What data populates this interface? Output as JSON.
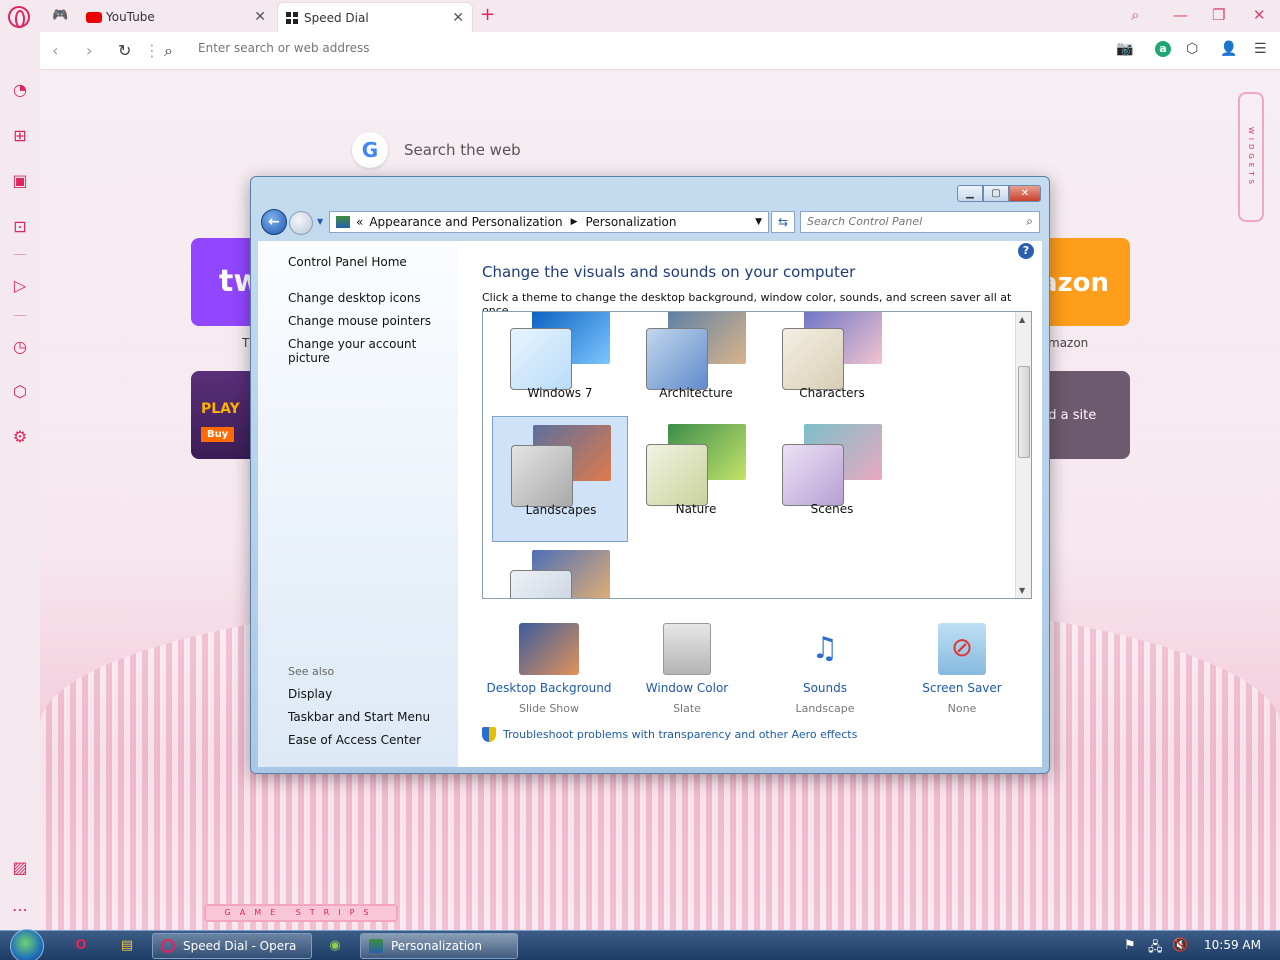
{
  "browser": {
    "tabs": [
      {
        "label": "YouTube",
        "active": false
      },
      {
        "label": "Speed Dial",
        "active": true
      }
    ],
    "address_placeholder": "Enter search or web address",
    "accent_color": "#e0245e"
  },
  "speed_dial": {
    "search_text": "Search the web",
    "tiles": [
      {
        "name": "twitch",
        "label": "tw",
        "caption": "T"
      },
      {
        "name": "game",
        "label": "PLAY",
        "button": "Buy"
      },
      {
        "name": "amazon",
        "label": "azon",
        "caption": "mazon"
      },
      {
        "name": "add",
        "label": "dd a site"
      }
    ],
    "widgets_label": "WIDGETS",
    "game_strips_label": "GAME STRIPS"
  },
  "control_panel": {
    "breadcrumb": [
      "Appearance and Personalization",
      "Personalization"
    ],
    "search_placeholder": "Search Control Panel",
    "left_links": [
      "Control Panel Home",
      "Change desktop icons",
      "Change mouse pointers",
      "Change your account picture"
    ],
    "see_also_label": "See also",
    "see_also_links": [
      "Display",
      "Taskbar and Start Menu",
      "Ease of Access Center"
    ],
    "heading": "Change the visuals and sounds on your computer",
    "description": "Click a theme to change the desktop background, window color, sounds, and screen saver all at once.",
    "themes": [
      {
        "name": "Windows 7",
        "selected": false
      },
      {
        "name": "Architecture",
        "selected": false
      },
      {
        "name": "Characters",
        "selected": false
      },
      {
        "name": "Landscapes",
        "selected": true
      },
      {
        "name": "Nature",
        "selected": false
      },
      {
        "name": "Scenes",
        "selected": false
      }
    ],
    "options": [
      {
        "title": "Desktop Background",
        "value": "Slide Show"
      },
      {
        "title": "Window Color",
        "value": "Slate"
      },
      {
        "title": "Sounds",
        "value": "Landscape"
      },
      {
        "title": "Screen Saver",
        "value": "None"
      }
    ],
    "troubleshoot_link": "Troubleshoot problems with transparency and other Aero effects"
  },
  "taskbar": {
    "tasks": [
      {
        "label": "Speed Dial - Opera"
      },
      {
        "label": "Personalization"
      }
    ],
    "clock": "10:59 AM"
  }
}
